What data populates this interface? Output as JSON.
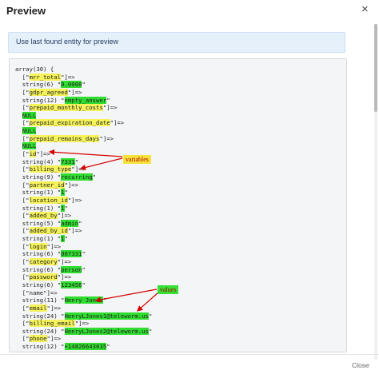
{
  "header": {
    "title": "Preview",
    "close_icon": "×"
  },
  "alert": {
    "text": "Use last found entity for preview"
  },
  "code_lines": [
    [
      {
        "t": "array(30) {"
      }
    ],
    [
      {
        "t": "  [\""
      },
      {
        "t": "mrr_total",
        "h": "y"
      },
      {
        "t": "\"]=>"
      }
    ],
    [
      {
        "t": "  string(6) \""
      },
      {
        "t": "0.0000",
        "h": "g"
      },
      {
        "t": "\""
      }
    ],
    [
      {
        "t": "  [\""
      },
      {
        "t": "gdpr_agreed",
        "h": "y"
      },
      {
        "t": "\"]=>"
      }
    ],
    [
      {
        "t": "  string(12) \""
      },
      {
        "t": "empty_answer",
        "h": "g"
      },
      {
        "t": "\""
      }
    ],
    [
      {
        "t": "  [\""
      },
      {
        "t": "prepaid_monthly_costs",
        "h": "y"
      },
      {
        "t": "\"]=>"
      }
    ],
    [
      {
        "t": "  "
      },
      {
        "t": "NULL",
        "h": "g"
      }
    ],
    [
      {
        "t": "  [\""
      },
      {
        "t": "prepaid_expiration_date",
        "h": "y"
      },
      {
        "t": "\"]=>"
      }
    ],
    [
      {
        "t": "  "
      },
      {
        "t": "NULL",
        "h": "g"
      }
    ],
    [
      {
        "t": "  [\""
      },
      {
        "t": "prepaid_remains_days",
        "h": "y"
      },
      {
        "t": "\"]=>"
      }
    ],
    [
      {
        "t": "  "
      },
      {
        "t": "NULL",
        "h": "g"
      }
    ],
    [
      {
        "t": "  [\""
      },
      {
        "t": "id",
        "h": "y"
      },
      {
        "t": "\"]=>"
      }
    ],
    [
      {
        "t": "  string(4) \""
      },
      {
        "t": "7331",
        "h": "g"
      },
      {
        "t": "\""
      }
    ],
    [
      {
        "t": "  [\""
      },
      {
        "t": "billing_type",
        "h": "y"
      },
      {
        "t": "\"]=>"
      }
    ],
    [
      {
        "t": "  string(9) \""
      },
      {
        "t": "recurring",
        "h": "g"
      },
      {
        "t": "\""
      }
    ],
    [
      {
        "t": "  [\""
      },
      {
        "t": "partner_id",
        "h": "y"
      },
      {
        "t": "\"]=>"
      }
    ],
    [
      {
        "t": "  string(1) \""
      },
      {
        "t": "1",
        "h": "g"
      },
      {
        "t": "\""
      }
    ],
    [
      {
        "t": "  [\""
      },
      {
        "t": "location_id",
        "h": "y"
      },
      {
        "t": "\"]=>"
      }
    ],
    [
      {
        "t": "  string(1) \""
      },
      {
        "t": "1",
        "h": "g"
      },
      {
        "t": "\""
      }
    ],
    [
      {
        "t": "  [\""
      },
      {
        "t": "added_by",
        "h": "y"
      },
      {
        "t": "\"]=>"
      }
    ],
    [
      {
        "t": "  string(5) \""
      },
      {
        "t": "admin",
        "h": "g"
      },
      {
        "t": "\""
      }
    ],
    [
      {
        "t": "  [\""
      },
      {
        "t": "added_by_id",
        "h": "y"
      },
      {
        "t": "\"]=>"
      }
    ],
    [
      {
        "t": "  string(1) \""
      },
      {
        "t": "1",
        "h": "g"
      },
      {
        "t": "\""
      }
    ],
    [
      {
        "t": "  [\""
      },
      {
        "t": "login",
        "h": "y"
      },
      {
        "t": "\"]=>"
      }
    ],
    [
      {
        "t": "  string(6) \""
      },
      {
        "t": "007331",
        "h": "g"
      },
      {
        "t": "\""
      }
    ],
    [
      {
        "t": "  [\""
      },
      {
        "t": "category",
        "h": "y"
      },
      {
        "t": "\"]=>"
      }
    ],
    [
      {
        "t": "  string(6) \""
      },
      {
        "t": "person",
        "h": "g"
      },
      {
        "t": "\""
      }
    ],
    [
      {
        "t": "  [\""
      },
      {
        "t": "password",
        "h": "y"
      },
      {
        "t": "\"]=>"
      }
    ],
    [
      {
        "t": "  string(6) \""
      },
      {
        "t": "123456",
        "h": "g"
      },
      {
        "t": "\""
      }
    ],
    [
      {
        "t": "  [\"name\"]=>"
      }
    ],
    [
      {
        "t": "  string(11) \""
      },
      {
        "t": "Henry Jones",
        "h": "g"
      },
      {
        "t": "\""
      }
    ],
    [
      {
        "t": "  [\""
      },
      {
        "t": "email",
        "h": "y"
      },
      {
        "t": "\"]=>"
      }
    ],
    [
      {
        "t": "  string(24) \""
      },
      {
        "t": "HenryLJones1@teleworm.us",
        "h": "g"
      },
      {
        "t": "\""
      }
    ],
    [
      {
        "t": "  [\""
      },
      {
        "t": "billing_email",
        "h": "y"
      },
      {
        "t": "\"]=>"
      }
    ],
    [
      {
        "t": "  string(24) \""
      },
      {
        "t": "HenryLJones2@teleworm.us",
        "h": "g"
      },
      {
        "t": "\""
      }
    ],
    [
      {
        "t": "  [\""
      },
      {
        "t": "phone",
        "h": "y"
      },
      {
        "t": "\"]=>"
      }
    ],
    [
      {
        "t": "  string(12) \""
      },
      {
        "t": "+14826643035",
        "h": "g"
      },
      {
        "t": "\""
      }
    ]
  ],
  "annotations": {
    "variables": "variables",
    "values": "values"
  },
  "footer": {
    "close_label": "Close"
  },
  "colors": {
    "key_highlight": "#f5f25a",
    "value_highlight": "#2fdc2f",
    "arrow": "#d40000"
  }
}
